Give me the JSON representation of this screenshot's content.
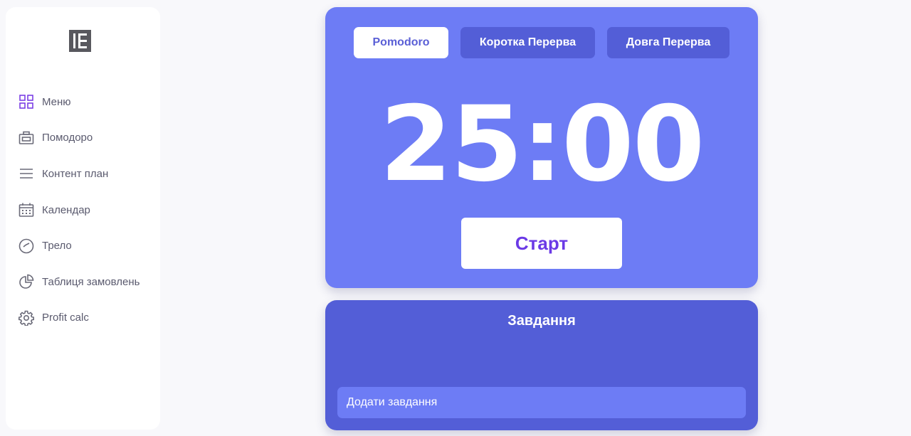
{
  "sidebar": {
    "logo_icon": "brand-logo-icon",
    "items": [
      {
        "label": "Меню",
        "icon": "grid-icon",
        "active": true
      },
      {
        "label": "Помодоро",
        "icon": "timer-box-icon"
      },
      {
        "label": "Контент план",
        "icon": "lines-icon"
      },
      {
        "label": "Календар",
        "icon": "calendar-icon"
      },
      {
        "label": "Трело",
        "icon": "check-circle-icon"
      },
      {
        "label": "Таблиця замовлень",
        "icon": "pie-chart-icon"
      },
      {
        "label": "Profit calc",
        "icon": "gear-icon"
      }
    ]
  },
  "timer": {
    "modes": [
      {
        "label": "Pomodoro",
        "active": true
      },
      {
        "label": "Коротка Перерва",
        "active": false
      },
      {
        "label": "Довга Перерва",
        "active": false
      }
    ],
    "time": "25:00",
    "start_label": "Старт"
  },
  "tasks": {
    "title": "Завдання",
    "input_placeholder": "Додати завдання"
  },
  "colors": {
    "accent": "#6d7cf5",
    "accent_dark": "#535ed7",
    "start_text": "#6b3ae6",
    "active_icon": "#7b3fe4",
    "sidebar_text": "#5a5a6e"
  }
}
